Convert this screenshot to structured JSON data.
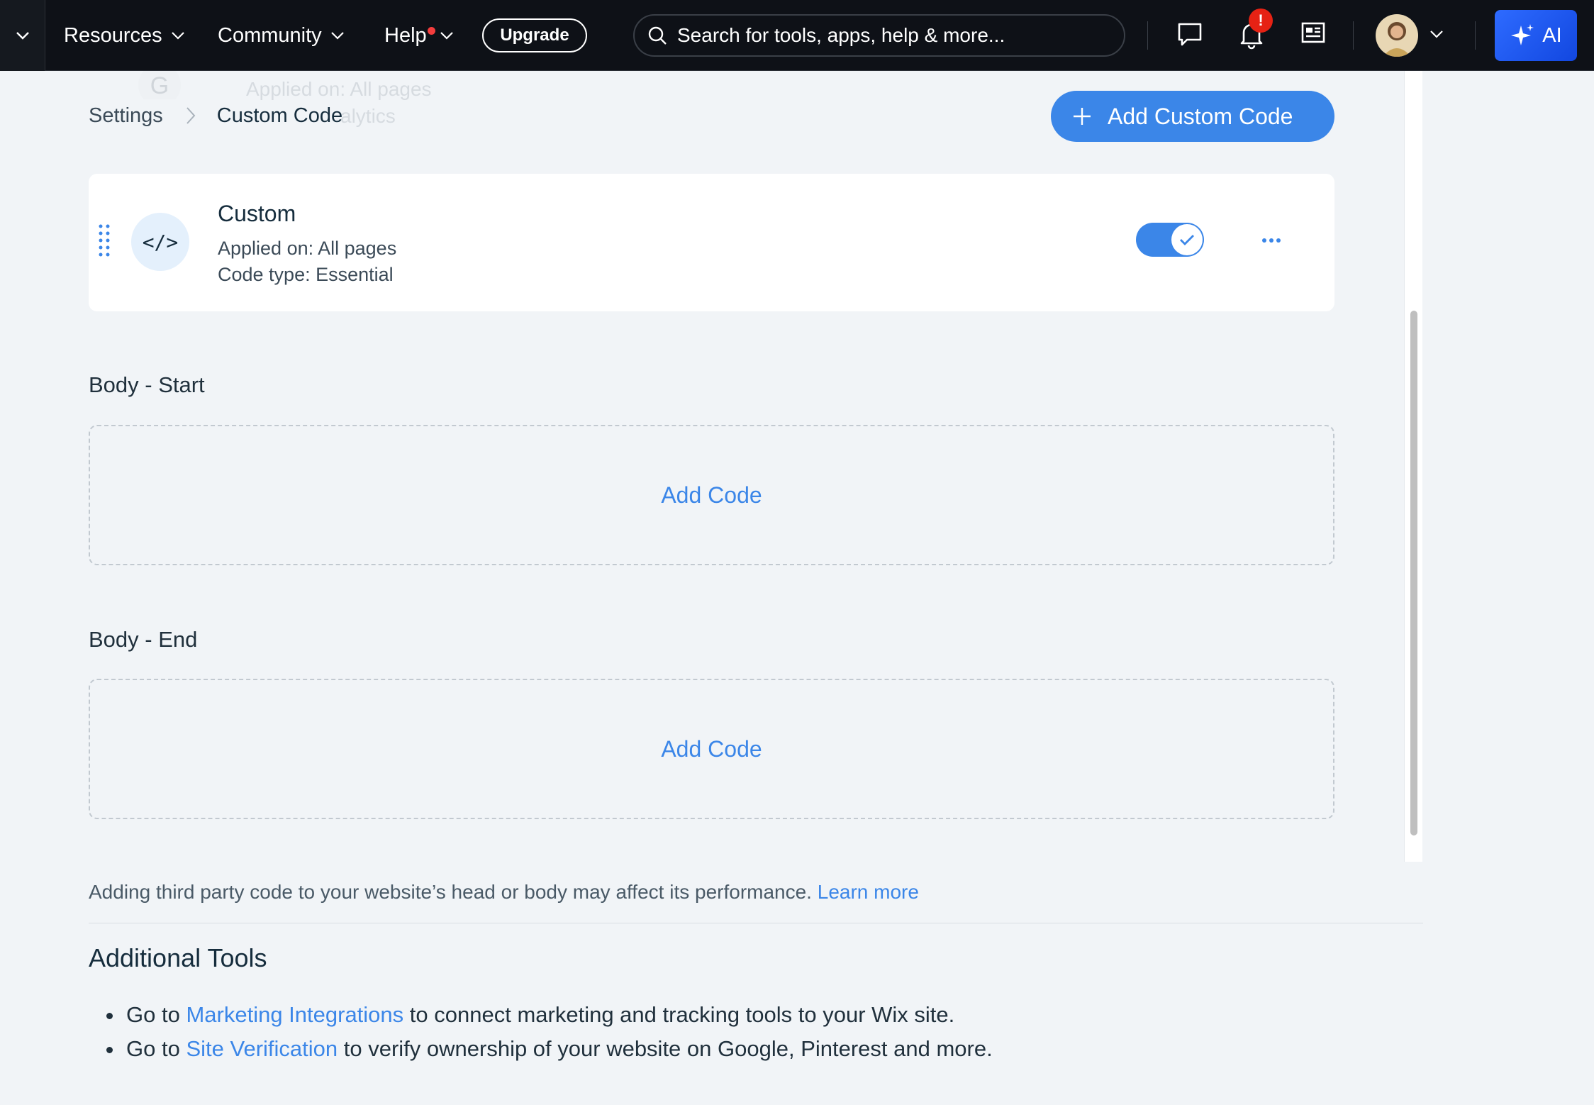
{
  "topbar": {
    "nav": [
      {
        "label": "Resources"
      },
      {
        "label": "Community"
      },
      {
        "label": "Help"
      }
    ],
    "upgrade_label": "Upgrade",
    "search_placeholder": "Search for tools, apps, help & more...",
    "notification_badge": "!",
    "ai_label": "AI",
    "colors": {
      "bar": "#0e1117",
      "ai": "#2e6bff",
      "badge": "#e62214"
    }
  },
  "ghost": {
    "line1": "Applied on: All pages",
    "line2": "alytics"
  },
  "breadcrumb": {
    "parent": "Settings",
    "current": "Custom Code"
  },
  "add_custom_code_label": "Add Custom Code",
  "card": {
    "icon_label": "</>",
    "title": "Custom",
    "applied_on": "Applied on: All pages",
    "code_type": "Code type: Essential",
    "enabled": true
  },
  "sections": [
    {
      "title": "Body - Start",
      "add_label": "Add Code"
    },
    {
      "title": "Body - End",
      "add_label": "Add Code"
    }
  ],
  "disclaimer": {
    "text": "Adding third party code to your website’s head or body may affect its performance.",
    "link": "Learn more"
  },
  "additional_tools": {
    "title": "Additional Tools",
    "items": [
      {
        "prefix": "Go to",
        "link": "Marketing Integrations",
        "suffix": "to connect marketing and tracking tools to your Wix site."
      },
      {
        "prefix": "Go to",
        "link": "Site Verification",
        "suffix": "to verify ownership of your website on Google, Pinterest and more."
      }
    ]
  },
  "accent_color": "#3b86e8"
}
